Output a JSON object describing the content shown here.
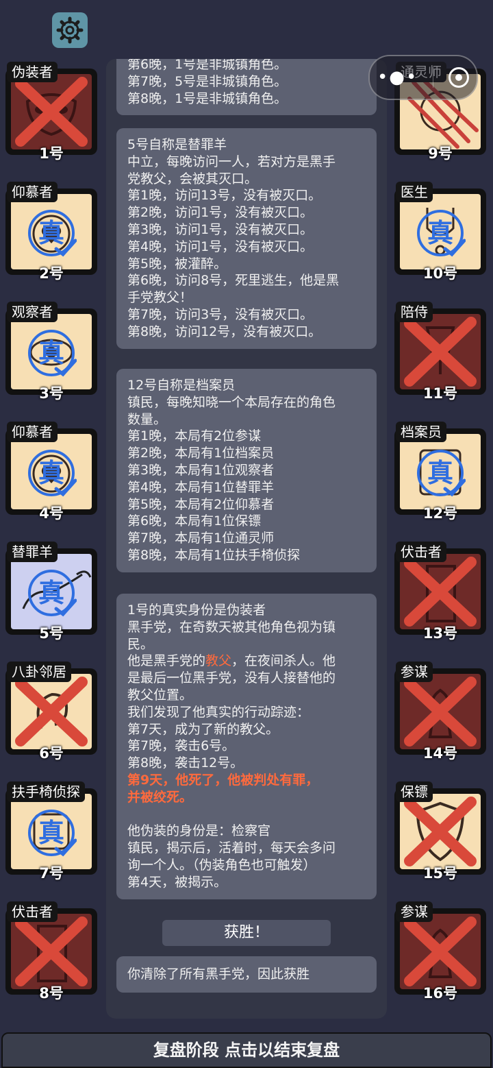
{
  "settings_icon": "gear-icon",
  "capsule": {
    "more_icon": "more-dots-icon",
    "close_icon": "close-circle-icon"
  },
  "stamp_text": "真",
  "log": {
    "box1": {
      "lines": [
        "第6晚，1号是非城镇角色。",
        "第7晚，5号是非城镇角色。",
        "第8晚，1号是非城镇角色。"
      ]
    },
    "box2": {
      "lines": [
        "5号自称是替罪羊",
        "中立，每晚访问一人，若对方是黑手",
        "党教父，会被其灭口。",
        "第1晚，访问13号，没有被灭口。",
        "第2晚，访问1号，没有被灭口。",
        "第3晚，访问1号，没有被灭口。",
        "第4晚，访问1号，没有被灭口。",
        "第5晚，被灌醉。",
        "第6晚，访问8号，死里逃生，他是黑",
        "手党教父！",
        "第7晚，访问3号，没有被灭口。",
        "第8晚，访问12号，没有被灭口。"
      ]
    },
    "box3": {
      "lines": [
        "12号自称是档案员",
        "镇民，每晚知晓一个本局存在的角色",
        "数量。",
        "第1晚，本局有2位参谋",
        "第2晚，本局有1位档案员",
        "第3晚，本局有1位观察者",
        "第4晚，本局有1位替罪羊",
        "第5晚，本局有2位仰慕者",
        "第6晚，本局有1位保镖",
        "第7晚，本局有1位通灵师",
        "第8晚，本局有1位扶手椅侦探"
      ]
    },
    "box4": {
      "l1": "1号的真实身份是伪装者",
      "l2": "黑手党，在奇数天被其他角色视为镇",
      "l3": "民。",
      "l4a": "他是黑手党的",
      "l4b": "教父",
      "l4c": "，在夜间杀人。他",
      "l5": "是最后一位黑手党，没有人接替他的",
      "l6": "教父位置。",
      "l7": "我们发现了他真实的行动踪迹：",
      "l8": "第7天，成为了新的教父。",
      "l9": "第7晚，袭击6号。",
      "l10": "第8晚，袭击12号。",
      "l11": "第9天，他死了，他被判处有罪，",
      "l12": "并被绞死。",
      "l13": "他伪装的身份是：检察官",
      "l14": "镇民，揭示后，活着时，每天会多问",
      "l15": "询一个人。（伪装角色也可触发）",
      "l16": "第4天，被揭示。"
    },
    "win_button": "获胜！",
    "box5": {
      "text": "你清除了所有黑手党，因此获胜"
    }
  },
  "bottom_bar": "复盘阶段 点击以结束复盘",
  "left_cards": [
    {
      "role": "伪装者",
      "num": "1号",
      "status": "dead",
      "icon": "mask-icon"
    },
    {
      "role": "仰慕者",
      "num": "2号",
      "status": "verified",
      "icon": "heart-icon"
    },
    {
      "role": "观察者",
      "num": "3号",
      "status": "verified",
      "icon": "eye-icon"
    },
    {
      "role": "仰慕者",
      "num": "4号",
      "status": "verified",
      "icon": "heart-icon"
    },
    {
      "role": "替罪羊",
      "num": "5号",
      "status": "verified",
      "icon": "goat-icon"
    },
    {
      "role": "八卦邻居",
      "num": "6号",
      "status": "dead",
      "icon": "ear-icon"
    },
    {
      "role": "扶手椅侦探",
      "num": "7号",
      "status": "verified",
      "icon": "chair-icon"
    },
    {
      "role": "伏击者",
      "num": "8号",
      "status": "dead",
      "icon": "door-icon"
    }
  ],
  "right_cards": [
    {
      "role": "通灵师",
      "num": "9号",
      "status": "dead",
      "icon": "crystal-ball-icon"
    },
    {
      "role": "医生",
      "num": "10号",
      "status": "verified",
      "icon": "stethoscope-icon"
    },
    {
      "role": "陪侍",
      "num": "11号",
      "status": "dead",
      "icon": "wine-glass-icon"
    },
    {
      "role": "档案员",
      "num": "12号",
      "status": "verified",
      "icon": "book-icon"
    },
    {
      "role": "伏击者",
      "num": "13号",
      "status": "dead",
      "icon": "door-icon"
    },
    {
      "role": "参谋",
      "num": "14号",
      "status": "dead",
      "icon": "chess-icon"
    },
    {
      "role": "保镖",
      "num": "15号",
      "status": "dead",
      "icon": "shield-icon"
    },
    {
      "role": "参谋",
      "num": "16号",
      "status": "dead",
      "icon": "chess-icon"
    }
  ],
  "colors": {
    "background": "#2b2d42",
    "highlight": "#ff6a3d",
    "stamp": "#2f6ee0",
    "cross": "#d9493a"
  }
}
